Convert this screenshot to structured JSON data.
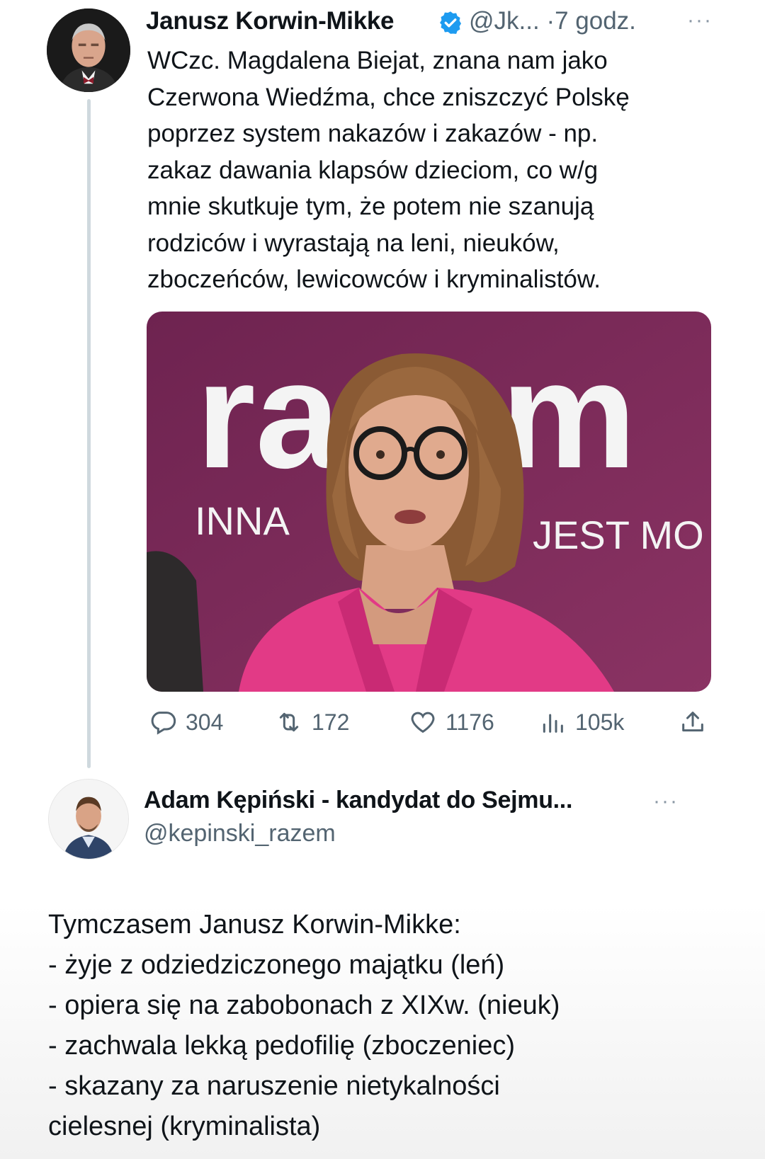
{
  "tweet": {
    "author_name": "Janusz Korwin-Mikke",
    "handle": "@Jk...",
    "separator": "·",
    "time": "7 godz.",
    "more": "···",
    "text": "WCzc. Magdalena Biejat, znana nam jako\nCzerwona Wiedźma, chce zniszczyć Polskę\npoprzez system nakazów i zakazów - np.\nzakaz dawania klapsów dzieciom, co w/g\nmnie skutkuje tym, że potem nie szanują\nrodziców i wyrastają na leni, nieuków,\nzboczeńców, lewicowców i kryminalistów.",
    "image_text": {
      "logo": "razem",
      "slogan_left": "INNA",
      "slogan_right": "JEST MO"
    },
    "stats": {
      "replies": "304",
      "retweets": "172",
      "likes": "1176",
      "views": "105k"
    }
  },
  "reply": {
    "author_name": "Adam Kępiński - kandydat do Sejmu...",
    "handle": "@kepinski_razem",
    "more": "···",
    "text": "Tymczasem Janusz Korwin-Mikke:\n- żyje z odziedziczonego majątku (leń)\n- opiera się na zabobonach z XIXw. (nieuk)\n- zachwala lekką pedofilię (zboczeniec)\n- skazany za naruszenie nietykalności\ncielesnej (kryminalista)"
  },
  "colors": {
    "text": "#0f1419",
    "secondary": "#536471",
    "verified": "#1d9bf0",
    "image_bg": "#7a2a57",
    "jacket": "#e23a86"
  }
}
